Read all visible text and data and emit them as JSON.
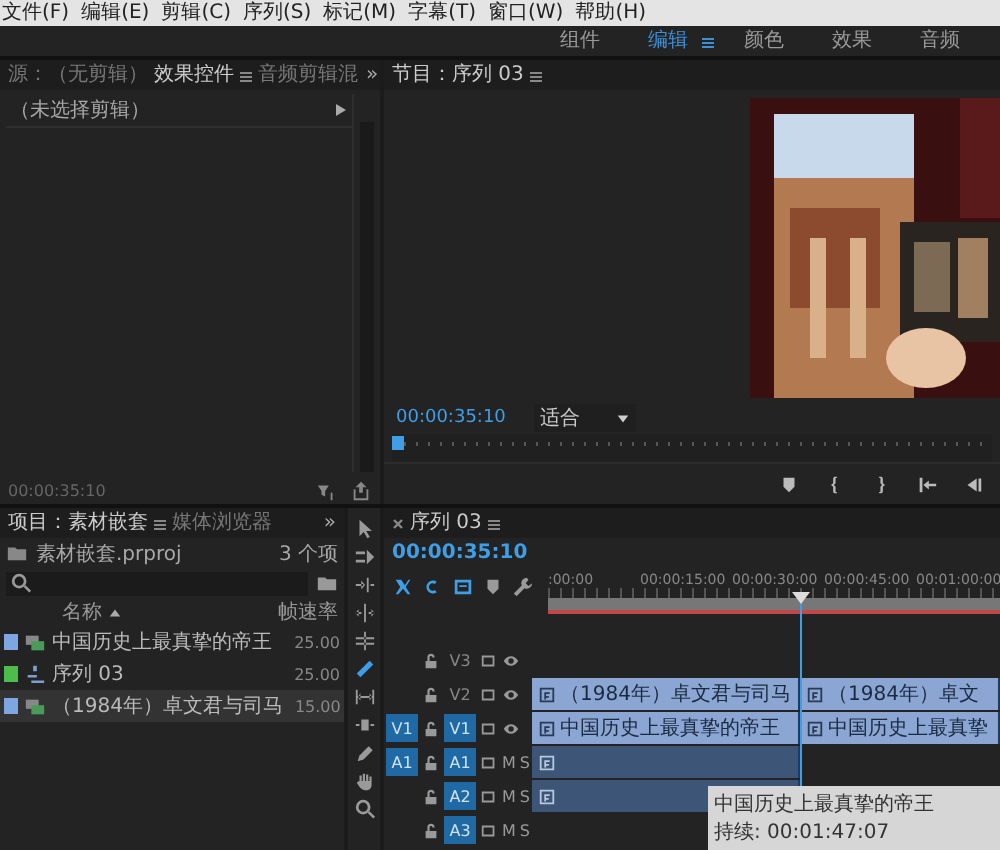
{
  "menu": [
    "文件(F)",
    "编辑(E)",
    "剪辑(C)",
    "序列(S)",
    "标记(M)",
    "字幕(T)",
    "窗口(W)",
    "帮助(H)"
  ],
  "workspaces": [
    {
      "label": "组件",
      "selected": false
    },
    {
      "label": "编辑",
      "selected": true
    },
    {
      "label": "颜色",
      "selected": false
    },
    {
      "label": "效果",
      "selected": false
    },
    {
      "label": "音频",
      "selected": false
    }
  ],
  "effects_panel": {
    "tabs": [
      {
        "label": "源：（无剪辑）",
        "selected": false
      },
      {
        "label": "效果控件",
        "selected": true
      },
      {
        "label": "音频剪辑混",
        "selected": false
      }
    ],
    "overflow": "»",
    "clip_header": "（未选择剪辑）",
    "timecode": "00:00:35:10"
  },
  "program_monitor": {
    "tab": "节目：序列 03",
    "timecode": "00:00:35:10",
    "zoom": "适合"
  },
  "project_panel": {
    "tabs": [
      {
        "label": "项目：素材嵌套",
        "selected": true
      },
      {
        "label": "媒体浏览器",
        "selected": false
      }
    ],
    "overflow": "»",
    "file": "素材嵌套.prproj",
    "count": "3 个项",
    "columns": [
      "名称",
      "帧速率"
    ],
    "items": [
      {
        "kind": "clip",
        "name": "中国历史上最真挚的帝王",
        "rate": "25.00",
        "color": "#7ea6e0",
        "selected": false
      },
      {
        "kind": "sequence",
        "name": "序列 03",
        "rate": "25.00",
        "color": "#4cbc4c",
        "selected": false
      },
      {
        "kind": "clip",
        "name": "（1984年）卓文君与司马",
        "rate": "15.00",
        "color": "#7ea6e0",
        "selected": true
      }
    ]
  },
  "tools": [
    {
      "selected": false
    },
    {
      "selected": false
    },
    {
      "selected": false
    },
    {
      "selected": false
    },
    {
      "selected": false
    },
    {
      "selected": true
    },
    {
      "selected": false
    },
    {
      "selected": false
    },
    {
      "selected": false
    },
    {
      "selected": false
    },
    {
      "selected": false
    }
  ],
  "timeline": {
    "tab": "序列 03",
    "timecode": "00:00:35:10",
    "toggles": [
      {
        "on": true
      },
      {
        "on": true
      },
      {
        "on": true
      },
      {
        "on": false
      },
      {
        "on": false
      }
    ],
    "ruler": [
      ":00:00",
      "00:00:15:00",
      "00:00:30:00",
      "00:00:45:00",
      "00:01:00:00"
    ],
    "tracks": [
      {
        "kind": "video",
        "name": "V3",
        "targeted": false
      },
      {
        "kind": "video",
        "name": "V2",
        "targeted": false,
        "clips": [
          {
            "kind": "video",
            "label": "（1984年）卓文君与司马"
          },
          {
            "kind": "video",
            "label": "（1984年）卓文"
          }
        ]
      },
      {
        "kind": "video",
        "name": "V1",
        "source": "V1",
        "targeted": true,
        "clips": [
          {
            "kind": "video",
            "label": "中国历史上最真挚的帝王"
          },
          {
            "kind": "video",
            "label": "中国历史上最真挚"
          }
        ]
      },
      {
        "kind": "audio",
        "name": "A1",
        "source": "A1",
        "targeted": true,
        "mute": "M",
        "solo": "S",
        "clips": [
          {
            "kind": "audio"
          }
        ]
      },
      {
        "kind": "audio",
        "name": "A2",
        "targeted": true,
        "mute": "M",
        "solo": "S",
        "clips": [
          {
            "kind": "audio"
          }
        ]
      },
      {
        "kind": "audio",
        "name": "A3",
        "targeted": true,
        "mute": "M",
        "solo": "S"
      }
    ],
    "tooltip": {
      "title": "中国历史上最真挚的帝王",
      "duration": "持续: 00:01:47:07"
    }
  }
}
